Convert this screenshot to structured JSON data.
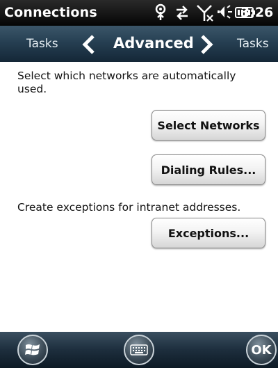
{
  "status": {
    "title": "Connections",
    "time": "3:26"
  },
  "tabs": {
    "prev": "Tasks",
    "current": "Advanced",
    "next": "Tasks"
  },
  "content": {
    "line1": "Select which networks are automatically",
    "line2": "used.",
    "select_networks": "Select Networks",
    "dialing_rules": "Dialing Rules...",
    "exceptions_text": "Create exceptions for intranet addresses.",
    "exceptions": "Exceptions..."
  },
  "bottom": {
    "ok": "OK"
  },
  "icons": [
    "signal-icon",
    "sync-icon",
    "no-signal-icon",
    "volume-icon",
    "battery-icon",
    "chevron-left-icon",
    "chevron-right-icon",
    "windows-start-icon",
    "keyboard-icon"
  ]
}
